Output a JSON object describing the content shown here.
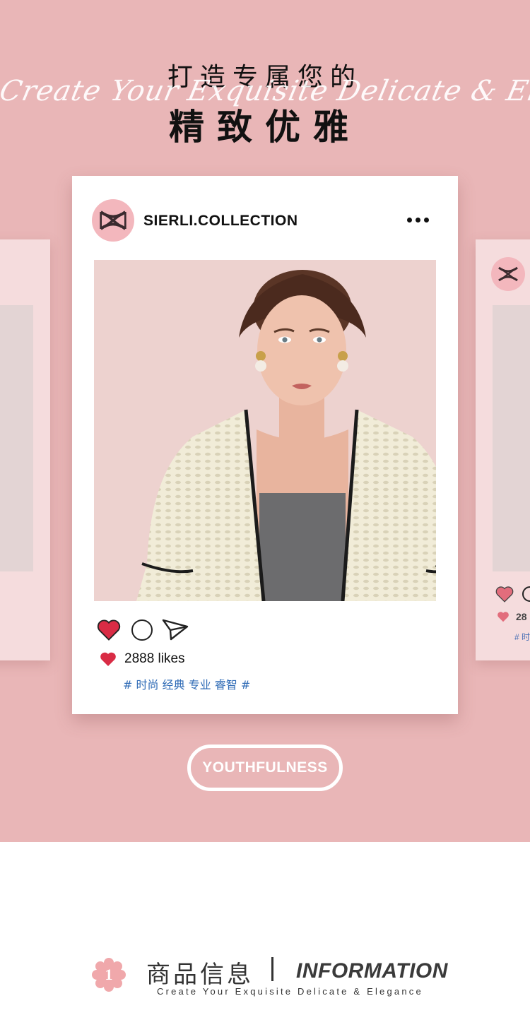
{
  "hero": {
    "line1": "打造专属您的",
    "script": "Create Your Exquisite Delicate & Elegance",
    "line2": "精致优雅"
  },
  "post": {
    "account": "SIERLI.COLLECTION",
    "likes_text": "2888 likes",
    "tags": "# 时尚 经典 专业 睿智 #",
    "icons": [
      "logo-icon",
      "more-icon",
      "heart-icon",
      "comment-icon",
      "share-icon"
    ]
  },
  "side_right": {
    "likes_partial": "28",
    "tag_partial": "# 时"
  },
  "pill_label": "YOUTHFULNESS",
  "info": {
    "number": "1",
    "title_cn": "商品信息",
    "title_en": "INFORMATION",
    "subtitle": "Create Your Exquisite Delicate & Elegance"
  },
  "colors": {
    "background_pink": "#e9b6b7",
    "card_white": "#ffffff",
    "heart_red": "#d92c45",
    "tag_blue": "#2f6bb6",
    "badge_pink": "#f0a8ab"
  }
}
